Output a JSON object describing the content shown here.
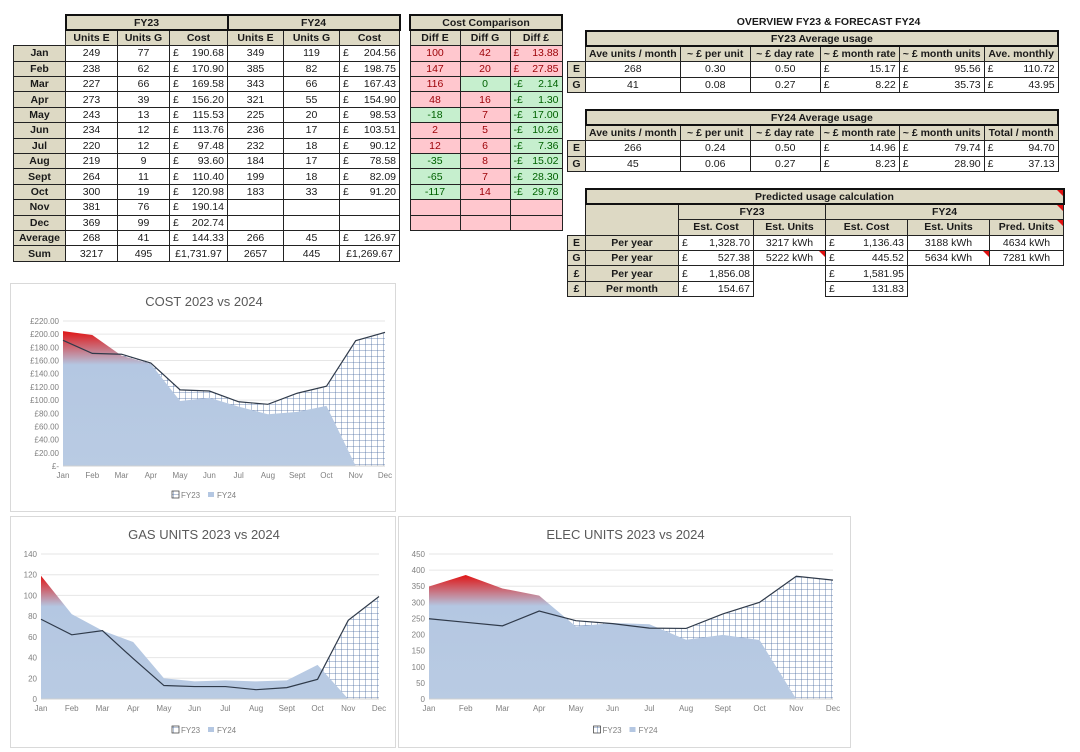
{
  "main_table": {
    "groups": [
      "FY23",
      "FY24"
    ],
    "columns": [
      "Units E",
      "Units G",
      "Cost"
    ],
    "rows": [
      {
        "month": "Jan",
        "fy23": [
          "249",
          "77",
          "190.68"
        ],
        "fy24": [
          "349",
          "119",
          "204.56"
        ]
      },
      {
        "month": "Feb",
        "fy23": [
          "238",
          "62",
          "170.90"
        ],
        "fy24": [
          "385",
          "82",
          "198.75"
        ]
      },
      {
        "month": "Mar",
        "fy23": [
          "227",
          "66",
          "169.58"
        ],
        "fy24": [
          "343",
          "66",
          "167.43"
        ]
      },
      {
        "month": "Apr",
        "fy23": [
          "273",
          "39",
          "156.20"
        ],
        "fy24": [
          "321",
          "55",
          "154.90"
        ]
      },
      {
        "month": "May",
        "fy23": [
          "243",
          "13",
          "115.53"
        ],
        "fy24": [
          "225",
          "20",
          "98.53"
        ]
      },
      {
        "month": "Jun",
        "fy23": [
          "234",
          "12",
          "113.76"
        ],
        "fy24": [
          "236",
          "17",
          "103.51"
        ]
      },
      {
        "month": "Jul",
        "fy23": [
          "220",
          "12",
          "97.48"
        ],
        "fy24": [
          "232",
          "18",
          "90.12"
        ]
      },
      {
        "month": "Aug",
        "fy23": [
          "219",
          "9",
          "93.60"
        ],
        "fy24": [
          "184",
          "17",
          "78.58"
        ]
      },
      {
        "month": "Sept",
        "fy23": [
          "264",
          "11",
          "110.40"
        ],
        "fy24": [
          "199",
          "18",
          "82.09"
        ]
      },
      {
        "month": "Oct",
        "fy23": [
          "300",
          "19",
          "120.98"
        ],
        "fy24": [
          "183",
          "33",
          "91.20"
        ]
      },
      {
        "month": "Nov",
        "fy23": [
          "381",
          "76",
          "190.14"
        ],
        "fy24": [
          "",
          "",
          ""
        ]
      },
      {
        "month": "Dec",
        "fy23": [
          "369",
          "99",
          "202.74"
        ],
        "fy24": [
          "",
          "",
          ""
        ]
      }
    ],
    "average": {
      "label": "Average",
      "fy23": [
        "268",
        "41",
        "144.33"
      ],
      "fy24": [
        "266",
        "45",
        "126.97"
      ]
    },
    "sum": {
      "label": "Sum",
      "fy23": [
        "3217",
        "495",
        "£1,731.97"
      ],
      "fy24": [
        "2657",
        "445",
        "£1,269.67"
      ]
    },
    "currency": "£"
  },
  "cost_comparison": {
    "title": "Cost Comparison",
    "columns": [
      "Diff E",
      "Diff G",
      "Diff £"
    ],
    "rows": [
      {
        "e": "100",
        "g": "42",
        "sign": "£",
        "cost": "13.88",
        "e_status": "worse",
        "g_status": "worse",
        "cost_status": "worse"
      },
      {
        "e": "147",
        "g": "20",
        "sign": "£",
        "cost": "27.85",
        "e_status": "worse",
        "g_status": "worse",
        "cost_status": "worse"
      },
      {
        "e": "116",
        "g": "0",
        "sign": "-£",
        "cost": "2.14",
        "e_status": "worse",
        "g_status": "better",
        "cost_status": "better"
      },
      {
        "e": "48",
        "g": "16",
        "sign": "-£",
        "cost": "1.30",
        "e_status": "worse",
        "g_status": "worse",
        "cost_status": "better"
      },
      {
        "e": "-18",
        "g": "7",
        "sign": "-£",
        "cost": "17.00",
        "e_status": "better",
        "g_status": "worse",
        "cost_status": "better"
      },
      {
        "e": "2",
        "g": "5",
        "sign": "-£",
        "cost": "10.26",
        "e_status": "worse",
        "g_status": "worse",
        "cost_status": "better"
      },
      {
        "e": "12",
        "g": "6",
        "sign": "-£",
        "cost": "7.36",
        "e_status": "worse",
        "g_status": "worse",
        "cost_status": "better"
      },
      {
        "e": "-35",
        "g": "8",
        "sign": "-£",
        "cost": "15.02",
        "e_status": "better",
        "g_status": "worse",
        "cost_status": "better"
      },
      {
        "e": "-65",
        "g": "7",
        "sign": "-£",
        "cost": "28.30",
        "e_status": "better",
        "g_status": "worse",
        "cost_status": "better"
      },
      {
        "e": "-117",
        "g": "14",
        "sign": "-£",
        "cost": "29.78",
        "e_status": "better",
        "g_status": "worse",
        "cost_status": "better"
      },
      {
        "e": "",
        "g": "",
        "sign": "",
        "cost": "",
        "e_status": "worse",
        "g_status": "worse",
        "cost_status": "worse"
      },
      {
        "e": "",
        "g": "",
        "sign": "",
        "cost": "",
        "e_status": "worse",
        "g_status": "worse",
        "cost_status": "worse"
      }
    ],
    "colors": {
      "worse_bg": "#ffc7ce",
      "worse_fg": "#9c0006",
      "better_bg": "#c6efce",
      "better_fg": "#006100"
    }
  },
  "overview": {
    "title": "OVERVIEW FY23 & FORECAST FY24",
    "fy23": {
      "title": "FY23 Average usage",
      "columns": [
        "Ave units / month",
        "~ £ per unit",
        "~ £ day rate",
        "~ £ month rate",
        "~ £ month units",
        "Ave. monthly"
      ],
      "rows": [
        {
          "label": "E",
          "values": [
            "268",
            "0.30",
            "0.50",
            "15.17",
            "95.56",
            "110.72"
          ]
        },
        {
          "label": "G",
          "values": [
            "41",
            "0.08",
            "0.27",
            "8.22",
            "35.73",
            "43.95"
          ]
        }
      ]
    },
    "fy24": {
      "title": "FY24 Average usage",
      "columns": [
        "Ave units / month",
        "~ £ per unit",
        "~ £ day rate",
        "~ £ month rate",
        "~ £ month units",
        "Total / month"
      ],
      "rows": [
        {
          "label": "E",
          "values": [
            "266",
            "0.24",
            "0.50",
            "14.96",
            "79.74",
            "94.70"
          ]
        },
        {
          "label": "G",
          "values": [
            "45",
            "0.06",
            "0.27",
            "8.23",
            "28.90",
            "37.13"
          ]
        }
      ]
    }
  },
  "predicted": {
    "title": "Predicted usage calculation",
    "fy23_label": "FY23",
    "fy24_label": "FY24",
    "columns": [
      "Est. Cost",
      "Est. Units",
      "Est. Cost",
      "Est. Units",
      "Pred. Units"
    ],
    "rows": [
      {
        "label": "E",
        "period": "Per year",
        "fy23_cost": "1,328.70",
        "fy23_units": "3217  kWh",
        "fy24_cost": "1,136.43",
        "fy24_units": "3188  kWh",
        "pred_units": "4634  kWh"
      },
      {
        "label": "G",
        "period": "Per year",
        "fy23_cost": "527.38",
        "fy23_units": "5222  kWh",
        "fy24_cost": "445.52",
        "fy24_units": "5634  kWh",
        "pred_units": "7281  kWh"
      },
      {
        "label": "£",
        "period": "Per year",
        "fy23_cost": "1,856.08",
        "fy24_cost": "1,581.95"
      },
      {
        "label": "£",
        "period": "Per month",
        "fy23_cost": "154.67",
        "fy24_cost": "131.83"
      }
    ]
  },
  "chart_data": [
    {
      "type": "area",
      "title": "COST 2023 vs 2024",
      "categories": [
        "Jan",
        "Feb",
        "Mar",
        "Apr",
        "May",
        "Jun",
        "Jul",
        "Aug",
        "Sept",
        "Oct",
        "Nov",
        "Dec"
      ],
      "series": [
        {
          "name": "FY23",
          "values": [
            190.68,
            170.9,
            169.58,
            156.2,
            115.53,
            113.76,
            97.48,
            93.6,
            110.4,
            120.98,
            190.14,
            202.74
          ],
          "style": "grid-pattern"
        },
        {
          "name": "FY24",
          "values": [
            204.56,
            198.75,
            167.43,
            154.9,
            98.53,
            103.51,
            90.12,
            78.58,
            82.09,
            91.2,
            0,
            0
          ],
          "style": "gradient-fill"
        }
      ],
      "yticks": [
        "£-",
        "£20.00",
        "£40.00",
        "£60.00",
        "£80.00",
        "£100.00",
        "£120.00",
        "£140.00",
        "£160.00",
        "£180.00",
        "£200.00",
        "£220.00"
      ],
      "ylim": [
        0,
        220
      ],
      "xlabel": "",
      "ylabel": "",
      "grid": true,
      "legend": "bottom"
    },
    {
      "type": "area",
      "title": "GAS UNITS 2023 vs 2024",
      "categories": [
        "Jan",
        "Feb",
        "Mar",
        "Apr",
        "May",
        "Jun",
        "Jul",
        "Aug",
        "Sept",
        "Oct",
        "Nov",
        "Dec"
      ],
      "series": [
        {
          "name": "FY23",
          "values": [
            77,
            62,
            66,
            39,
            13,
            12,
            12,
            9,
            11,
            19,
            76,
            99
          ],
          "style": "grid-pattern"
        },
        {
          "name": "FY24",
          "values": [
            119,
            82,
            66,
            55,
            20,
            17,
            18,
            17,
            18,
            33,
            0,
            0
          ],
          "style": "gradient-fill"
        }
      ],
      "yticks": [
        "0",
        "20",
        "40",
        "60",
        "80",
        "100",
        "120",
        "140"
      ],
      "ylim": [
        0,
        140
      ],
      "xlabel": "",
      "ylabel": "",
      "grid": true,
      "legend": "bottom"
    },
    {
      "type": "area",
      "title": "ELEC UNITS 2023 vs 2024",
      "categories": [
        "Jan",
        "Feb",
        "Mar",
        "Apr",
        "May",
        "Jun",
        "Jul",
        "Aug",
        "Sept",
        "Oct",
        "Nov",
        "Dec"
      ],
      "series": [
        {
          "name": "FY23",
          "values": [
            249,
            238,
            227,
            273,
            243,
            234,
            220,
            219,
            264,
            300,
            381,
            369
          ],
          "style": "grid-pattern"
        },
        {
          "name": "FY24",
          "values": [
            349,
            385,
            343,
            321,
            225,
            236,
            232,
            184,
            199,
            183,
            0,
            0
          ],
          "style": "gradient-fill"
        }
      ],
      "yticks": [
        "0",
        "50",
        "100",
        "150",
        "200",
        "250",
        "300",
        "350",
        "400",
        "450"
      ],
      "ylim": [
        0,
        450
      ],
      "xlabel": "",
      "ylabel": "",
      "grid": true,
      "legend": "bottom"
    }
  ]
}
